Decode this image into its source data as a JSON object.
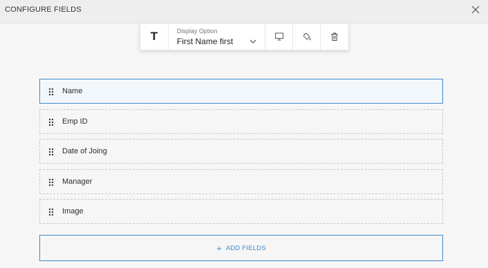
{
  "header": {
    "title": "CONFIGURE FIELDS",
    "close_icon": "close-icon"
  },
  "toolbar": {
    "text_tool_label": "T",
    "display_option": {
      "label": "Display Option",
      "value": "First Name first"
    },
    "icons": [
      "monitor-icon",
      "paint-bucket-icon",
      "trash-icon"
    ]
  },
  "fields": [
    {
      "label": "Name",
      "active": true
    },
    {
      "label": "Emp ID",
      "active": false
    },
    {
      "label": "Date of Joing",
      "active": false
    },
    {
      "label": "Manager",
      "active": false
    },
    {
      "label": "Image",
      "active": false
    }
  ],
  "add_button": {
    "label": "ADD FIELDS"
  },
  "colors": {
    "accent": "#3f86c7",
    "background": "#f6f6f6",
    "header_bg": "#eeeeee"
  }
}
